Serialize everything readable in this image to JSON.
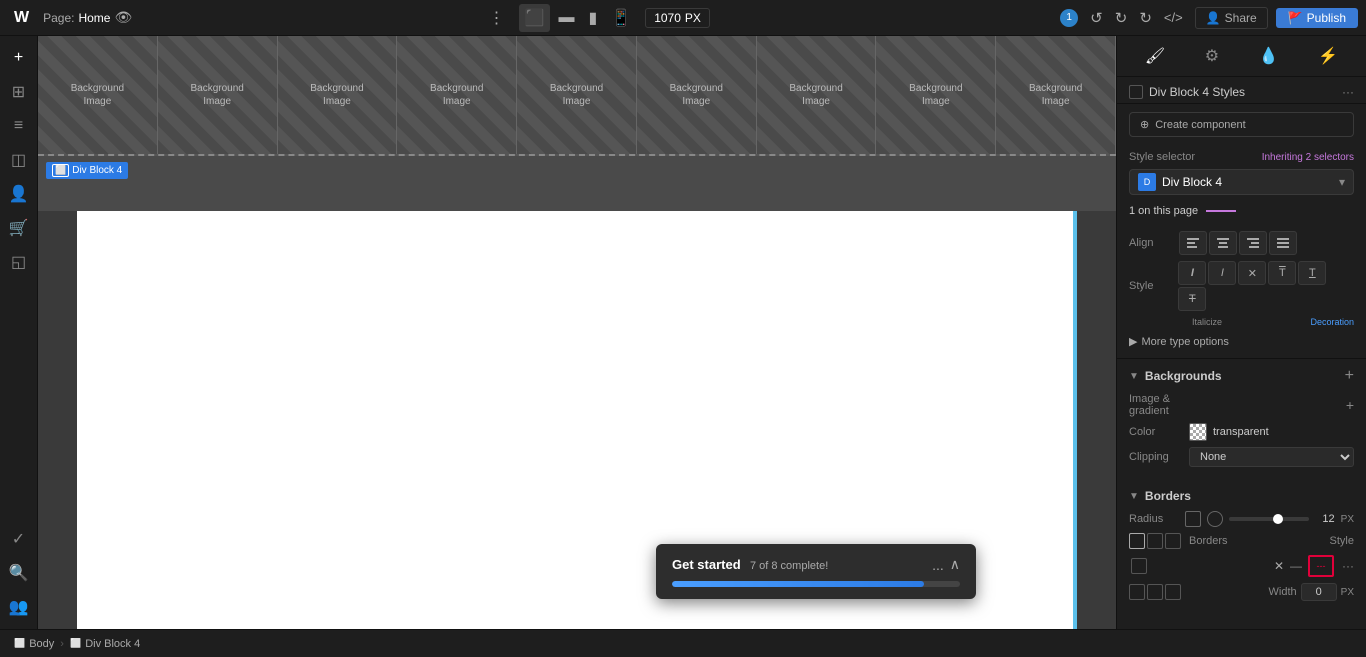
{
  "topbar": {
    "logo": "W",
    "page_label": "Page:",
    "page_name": "Home",
    "dots_icon": "⋮",
    "width_value": "1070",
    "width_unit": "PX",
    "badge_count": "1",
    "undo_icon": "↺",
    "redo_icon": "↻",
    "refresh_icon": "↻",
    "code_icon": "</>",
    "share_icon": "👤",
    "share_label": "Share",
    "publish_icon": "🚩",
    "publish_label": "Publish"
  },
  "left_sidebar": {
    "icons": [
      "+",
      "⊞",
      "≡",
      "◫",
      "👤",
      "🛒",
      "◱",
      "✓",
      "🔍",
      "👥"
    ]
  },
  "canvas": {
    "bg_tiles": [
      {
        "label1": "Background",
        "label2": "Image"
      },
      {
        "label1": "Background",
        "label2": "Image"
      },
      {
        "label1": "Background",
        "label2": "Image"
      },
      {
        "label1": "Background",
        "label2": "Image"
      },
      {
        "label1": "Background",
        "label2": "Image"
      },
      {
        "label1": "Background",
        "label2": "Image"
      },
      {
        "label1": "Background",
        "label2": "Image"
      },
      {
        "label1": "Background",
        "label2": "Image"
      },
      {
        "label1": "Background",
        "label2": "Image"
      }
    ],
    "div_block_label": "Div Block 4"
  },
  "toast": {
    "title": "Get started",
    "progress_text": "7 of 8 complete!",
    "progress_percent": 87.5,
    "dots": "...",
    "collapse": "∧"
  },
  "breadcrumb": {
    "items": [
      {
        "icon": "⬜",
        "label": "Body"
      },
      {
        "sep": ">"
      },
      {
        "icon": "⬜",
        "label": "Div Block 4"
      }
    ]
  },
  "right_panel": {
    "tabs": [
      {
        "icon": "🖌",
        "label": "style"
      },
      {
        "icon": "⚙",
        "label": "settings"
      },
      {
        "icon": "💧",
        "label": "interactions"
      },
      {
        "icon": "⚡",
        "label": "triggers"
      }
    ],
    "styles_header": {
      "title": "Div Block 4 Styles",
      "more": "···"
    },
    "create_component": "Create component",
    "style_selector": {
      "label": "Style selector",
      "inherit_text": "Inheriting",
      "inherit_count": "2 selectors",
      "block_name": "Div Block 4"
    },
    "on_this_page": "1 on this page",
    "align": {
      "label": "Align",
      "buttons": [
        "≡",
        "≡",
        "≡",
        "≡"
      ]
    },
    "style": {
      "label": "Style",
      "italicize_label": "Italicize",
      "decoration_label": "Decoration",
      "buttons": [
        "I",
        "I",
        "✕",
        "⊤",
        "T",
        "T"
      ]
    },
    "more_type_options": "More type options",
    "backgrounds": {
      "section_title": "Backgrounds",
      "image_gradient_label": "Image & gradient",
      "color_label": "Color",
      "color_value": "transparent",
      "clipping_label": "Clipping",
      "clipping_value": "None"
    },
    "borders": {
      "section_title": "Borders",
      "radius_label": "Radius",
      "radius_value": "12",
      "radius_unit": "PX",
      "borders_label": "Borders",
      "style_label": "Style",
      "width_label": "Width",
      "width_value": "0",
      "width_unit": "PX"
    }
  }
}
